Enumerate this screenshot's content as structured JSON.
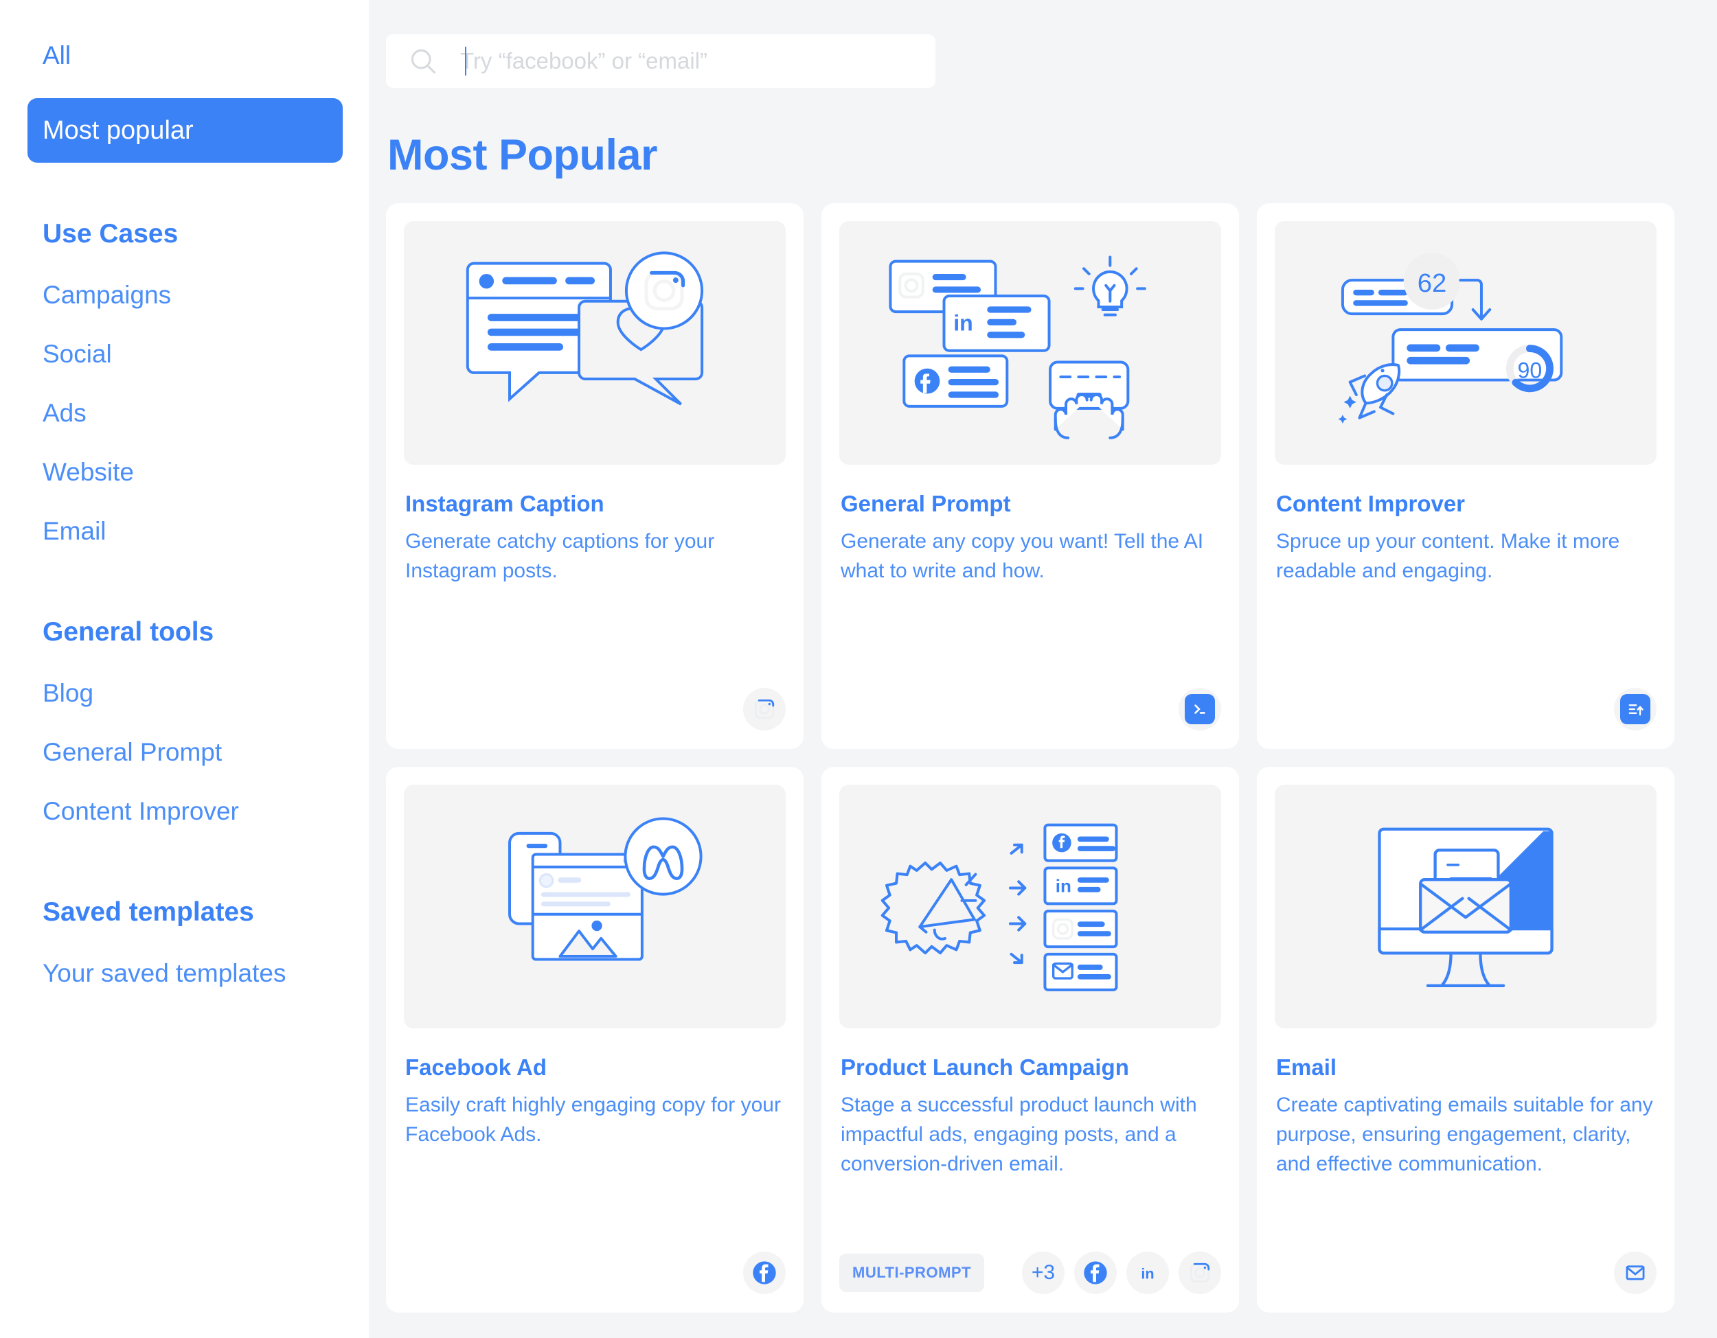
{
  "sidebar": {
    "top_items": [
      {
        "label": "All",
        "active": false
      },
      {
        "label": "Most popular",
        "active": true
      }
    ],
    "sections": [
      {
        "title": "Use Cases",
        "items": [
          "Campaigns",
          "Social",
          "Ads",
          "Website",
          "Email"
        ]
      },
      {
        "title": "General tools",
        "items": [
          "Blog",
          "General Prompt",
          "Content Improver"
        ]
      },
      {
        "title": "Saved templates",
        "items": [
          "Your saved templates"
        ]
      }
    ]
  },
  "search": {
    "placeholder": "Try “facebook” or “email”",
    "value": "",
    "icon": "search-icon"
  },
  "header": {
    "title": "Most Popular"
  },
  "colors": {
    "accent": "#3b82f6",
    "accent_text": "#4b8ef7",
    "page_bg": "#f4f5f6",
    "card_bg": "#ffffff",
    "illo_bg": "#f4f4f5",
    "chip_bg": "#f4f4f5"
  },
  "cards": [
    {
      "id": "instagram-caption",
      "title": "Instagram Caption",
      "description": "Generate catchy captions for your Instagram posts.",
      "illustration": "instagram-chat-bubbles-illustration",
      "badges": [
        {
          "type": "icon",
          "icon": "instagram-icon",
          "style": "outline"
        }
      ]
    },
    {
      "id": "general-prompt",
      "title": "General Prompt",
      "description": "Generate any copy you want! Tell the AI what to write and how.",
      "illustration": "social-cards-lightbulb-keyboard-illustration",
      "badges": [
        {
          "type": "icon",
          "icon": "terminal-prompt-icon",
          "style": "solid"
        }
      ]
    },
    {
      "id": "content-improver",
      "title": "Content Improver",
      "description": "Spruce up your content. Make it more readable and engaging.",
      "illustration": "content-score-rocket-illustration",
      "illustration_values": {
        "score_before": "62",
        "score_after": "90"
      },
      "badges": [
        {
          "type": "icon",
          "icon": "content-improver-icon",
          "style": "solid"
        }
      ]
    },
    {
      "id": "facebook-ad",
      "title": "Facebook Ad",
      "description": "Easily craft highly engaging copy for your Facebook Ads.",
      "illustration": "meta-browser-post-illustration",
      "badges": [
        {
          "type": "icon",
          "icon": "facebook-icon",
          "style": "solid-circle"
        }
      ]
    },
    {
      "id": "product-launch-campaign",
      "title": "Product Launch Campaign",
      "description": "Stage a successful product launch with impactful ads, engaging posts, and a conversion-driven email.",
      "illustration": "megaphone-channels-illustration",
      "tag": "MULTI-PROMPT",
      "badges": [
        {
          "type": "count",
          "label": "+3"
        },
        {
          "type": "icon",
          "icon": "facebook-icon",
          "style": "solid-circle"
        },
        {
          "type": "icon",
          "icon": "linkedin-icon",
          "style": "glyph"
        },
        {
          "type": "icon",
          "icon": "instagram-icon",
          "style": "outline"
        }
      ]
    },
    {
      "id": "email",
      "title": "Email",
      "description": "Create captivating emails suitable for any purpose, ensuring engagement, clarity, and effective communication.",
      "illustration": "desktop-envelope-illustration",
      "badges": [
        {
          "type": "icon",
          "icon": "envelope-icon",
          "style": "outline"
        }
      ]
    }
  ]
}
